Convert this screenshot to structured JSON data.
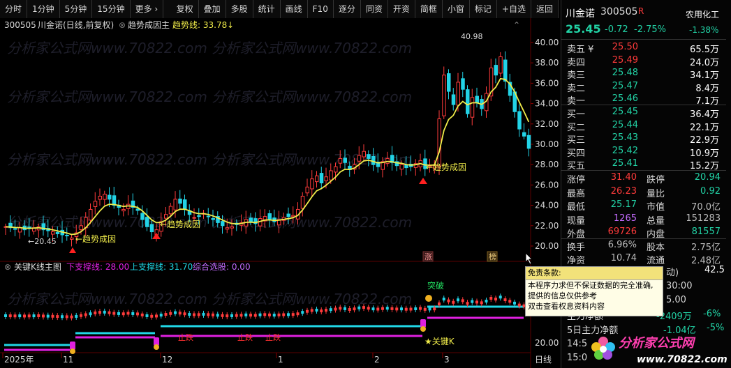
{
  "toolbar": {
    "left_items": [
      "分时",
      "1分钟",
      "5分钟",
      "15分钟",
      "更多 ›"
    ],
    "right_items": [
      "复权",
      "叠加",
      "多股",
      "统计",
      "画线",
      "F10",
      "逐分",
      "同资",
      "开资",
      "简框",
      "小窗",
      "标记",
      "+自选",
      "返回"
    ]
  },
  "chart": {
    "title_code": "300505",
    "title_name": "川金诺(日线,前复权)",
    "indicator_name": "趋势成因主",
    "trend_line_label": "趋势线: 33.78",
    "y_labels": [
      "40.00",
      "38.00",
      "36.00",
      "34.00",
      "32.00",
      "30.00",
      "28.00",
      "26.00",
      "24.00",
      "22.00",
      "20.00"
    ],
    "high_marker": "40.98",
    "low_marker": "←20.45",
    "annotations": [
      "←趋势成因",
      "←趋势成因",
      "←趋势成因"
    ],
    "tags": [
      "涨",
      "榜"
    ],
    "lower_title": "关键K线主图",
    "lower_support_down": "下支撑线: 28.00",
    "lower_support_up": "上支撑线: 31.70",
    "lower_select": "综合选股: 0.00",
    "lower_y_label": "20.00",
    "lower_annotations": [
      "突破",
      "★关键K",
      "止跌",
      "止跌",
      "止跌"
    ],
    "x_labels": [
      "2025年",
      "11",
      "12",
      "1",
      "2",
      "3",
      "日线"
    ],
    "watermark": "分析家公式网www.70822.com"
  },
  "quote": {
    "name": "川金诺",
    "code": "300505",
    "flag": "R",
    "sector": "农用化工",
    "sector_change": "-1.38%",
    "price": "25.45",
    "change": "-0.72",
    "change_pct": "-2.75%",
    "asks": [
      {
        "label": "卖五 ¥",
        "price": "25.50",
        "vol": "65.5万"
      },
      {
        "label": "卖四",
        "price": "25.49",
        "vol": "24.0万"
      },
      {
        "label": "卖三",
        "price": "25.48",
        "vol": "34.1万"
      },
      {
        "label": "卖二",
        "price": "25.47",
        "vol": "8.4万"
      },
      {
        "label": "卖一",
        "price": "25.46",
        "vol": "7.1万"
      }
    ],
    "bids": [
      {
        "label": "买一",
        "price": "25.45",
        "vol": "36.4万"
      },
      {
        "label": "买二",
        "price": "25.44",
        "vol": "22.1万"
      },
      {
        "label": "买三",
        "price": "25.43",
        "vol": "22.9万"
      },
      {
        "label": "买四",
        "price": "25.42",
        "vol": "10.9万"
      },
      {
        "label": "买五",
        "price": "25.41",
        "vol": "15.2万"
      }
    ],
    "stats": [
      {
        "l1": "涨停",
        "v1": "31.40",
        "c1": "up",
        "l2": "跌停",
        "v2": "20.94",
        "c2": "dn"
      },
      {
        "l1": "最高",
        "v1": "26.23",
        "c1": "up",
        "l2": "量比",
        "v2": "0.92",
        "c2": "dn"
      },
      {
        "l1": "最低",
        "v1": "25.17",
        "c1": "dn",
        "l2": "市值",
        "v2": "70.0亿",
        "c2": "gray"
      },
      {
        "l1": "现量",
        "v1": "1265",
        "c1": "purple",
        "l2": "总量",
        "v2": "151283",
        "c2": "gray"
      },
      {
        "l1": "外盘",
        "v1": "69726",
        "c1": "up",
        "l2": "内盘",
        "v2": "81557",
        "c2": "dn"
      }
    ],
    "stats2": [
      {
        "l1": "换手",
        "v1": "6.96%",
        "l2": "股本",
        "v2": "2.75亿"
      },
      {
        "l1": "净资",
        "v1": "10.74",
        "l2": "流通",
        "v2": "2.48亿"
      }
    ],
    "partial": [
      "动)",
      "42.5",
      "30:00",
      "5.00",
      "主力净额",
      "-2409万",
      "-6%",
      "5日主力净额",
      "-1.04亿",
      "-5%",
      "14:5",
      "15:0"
    ]
  },
  "disclaimer": {
    "title": "免责条款:",
    "lines": [
      "本程序力求但不保证数据的完全准确,",
      "提供的信息仅供参考",
      "双击查看权息资料内容"
    ]
  },
  "logo": {
    "text": "分析家公式网",
    "url": "www.70822.com"
  },
  "colors": {
    "up": "#ff3b3b",
    "down": "#22d3a6",
    "trend": "#f0ec4a",
    "support": "#21d7e6",
    "support2": "#e020e0"
  }
}
